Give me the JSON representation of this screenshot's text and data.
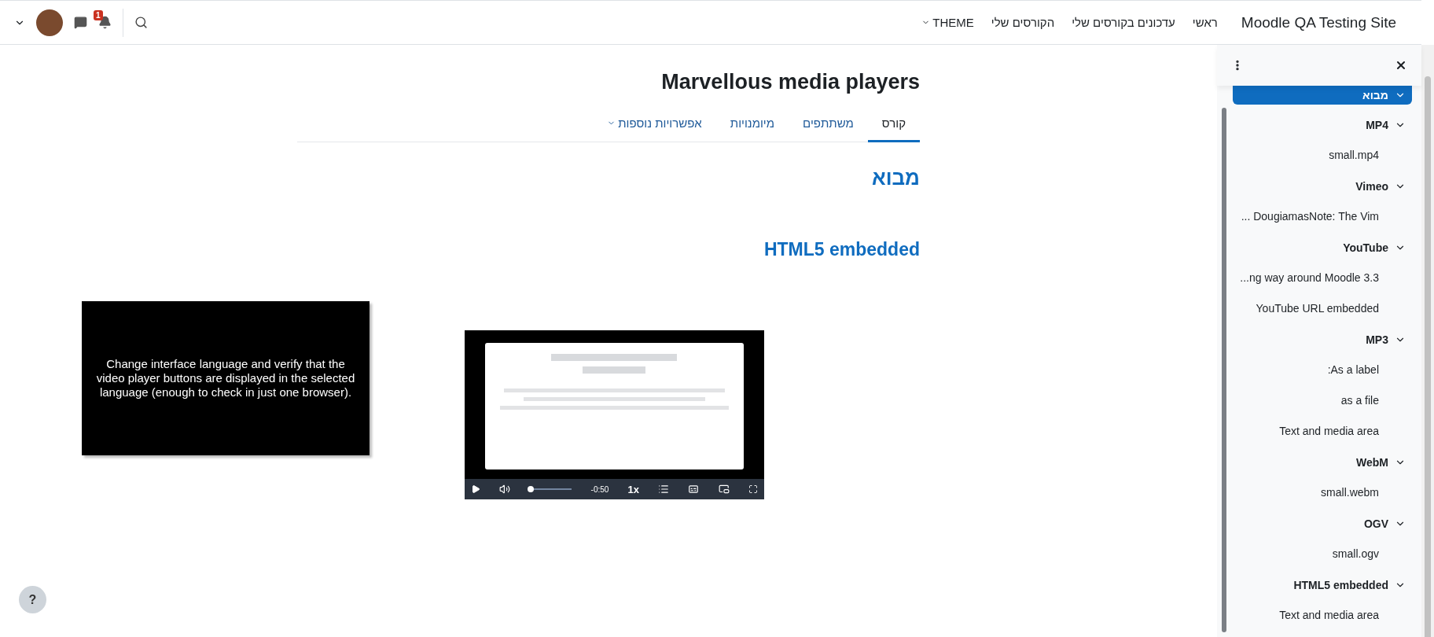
{
  "navbar": {
    "site_name": "Moodle QA Testing Site",
    "links": [
      {
        "label": "ראשי",
        "kind": "link"
      },
      {
        "label": "עדכונים בקורסים שלי",
        "kind": "link"
      },
      {
        "label": "הקורסים שלי",
        "kind": "link"
      },
      {
        "label": "THEME",
        "kind": "dropdown"
      }
    ],
    "notification_count": "1"
  },
  "course": {
    "title": "Marvellous media players",
    "tabs": [
      {
        "label": "קורס",
        "selected": true,
        "kind": "tab"
      },
      {
        "label": "משתתפים",
        "selected": false,
        "kind": "tab"
      },
      {
        "label": "מיומנויות",
        "selected": false,
        "kind": "tab"
      },
      {
        "label": "אפשרויות נוספות",
        "selected": false,
        "kind": "dropdown"
      }
    ],
    "section_headings": [
      "מבוא",
      "HTML5 embedded"
    ],
    "note": "Change interface language and verify that the video player buttons are displayed in the selected language (enough to check in just one browser).",
    "video": {
      "kind": "picture",
      "progress": {
        "level": 0.03
      },
      "time": "-0:50",
      "speed": "1x"
    }
  },
  "drawer": {
    "sections": [
      {
        "title": "מבוא",
        "expanded": true,
        "active": true
      },
      {
        "title": "MP4",
        "expanded": true,
        "active": false,
        "items": [
          "small.mp4"
        ]
      },
      {
        "title": "Vimeo",
        "expanded": true,
        "active": false,
        "items": [
          "... DougiamasNote: The Vim"
        ]
      },
      {
        "title": "YouTube",
        "expanded": true,
        "active": false,
        "items": [
          "...ng way around Moodle 3.3",
          "YouTube URL embedded"
        ]
      },
      {
        "title": "MP3",
        "expanded": true,
        "active": false,
        "items": [
          ":As a label",
          "as a file",
          "Text and media area"
        ]
      },
      {
        "title": "WebM",
        "expanded": true,
        "active": false,
        "items": [
          "small.webm"
        ]
      },
      {
        "title": "OGV",
        "expanded": true,
        "active": false,
        "items": [
          "small.ogv"
        ]
      },
      {
        "title": "HTML5 embedded",
        "expanded": true,
        "active": false,
        "items": [
          "Text and media area"
        ]
      }
    ]
  },
  "help": "?"
}
